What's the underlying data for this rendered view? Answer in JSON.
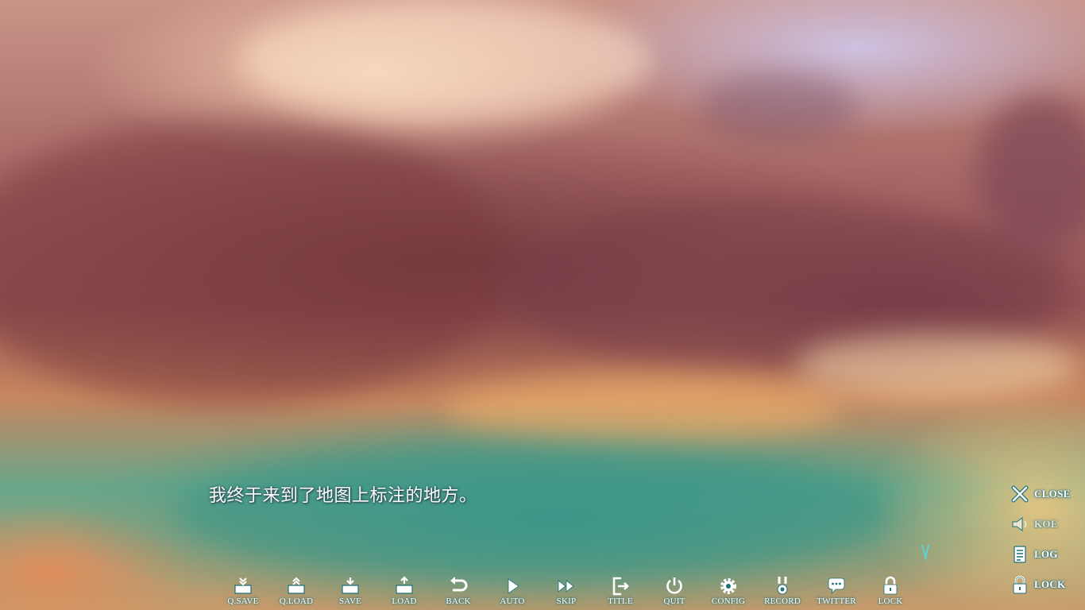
{
  "dialogue": {
    "text": "我终于来到了地图上标注的地方。"
  },
  "toolbar": {
    "buttons": [
      {
        "label": "Q.SAVE",
        "icon": "quick-save-icon"
      },
      {
        "label": "Q.LOAD",
        "icon": "quick-load-icon"
      },
      {
        "label": "SAVE",
        "icon": "save-icon"
      },
      {
        "label": "LOAD",
        "icon": "load-icon"
      },
      {
        "label": "BACK",
        "icon": "back-arrow-icon"
      },
      {
        "label": "AUTO",
        "icon": "play-icon"
      },
      {
        "label": "SKIP",
        "icon": "fast-forward-icon"
      },
      {
        "label": "TITLE",
        "icon": "exit-door-icon"
      },
      {
        "label": "QUIT",
        "icon": "power-icon"
      },
      {
        "label": "CONFIG",
        "icon": "gear-icon"
      },
      {
        "label": "RECORD",
        "icon": "medal-icon"
      },
      {
        "label": "TWITTER",
        "icon": "speech-bubble-icon"
      },
      {
        "label": "LOCK",
        "icon": "padlock-icon"
      }
    ]
  },
  "side_menu": {
    "close_label": "CLOSE",
    "koe_label": "KOE",
    "log_label": "LOG",
    "lock_label": "LOCK"
  },
  "colors": {
    "icon_fill": "#ffffff",
    "icon_outline": "#1d6f7a",
    "text_color": "#ffffff"
  }
}
